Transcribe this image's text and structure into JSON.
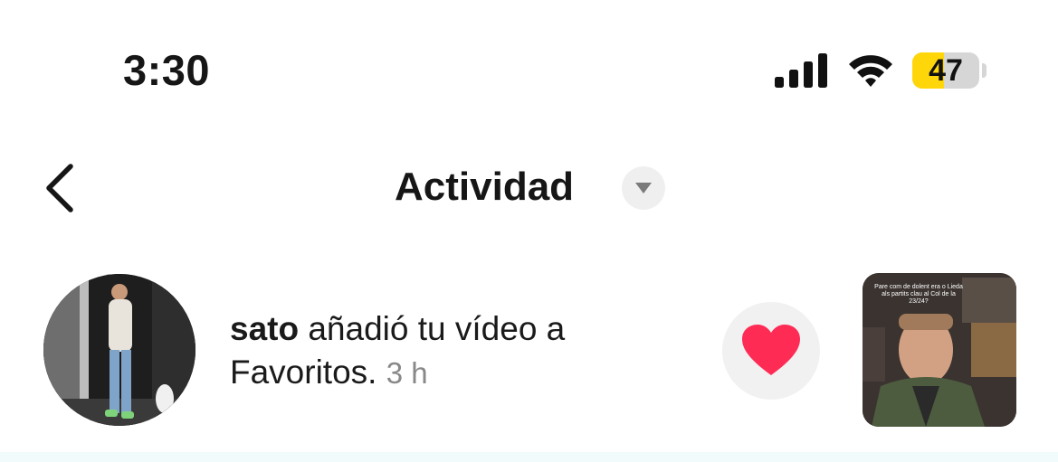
{
  "status_bar": {
    "time": "3:30",
    "battery_level": "47",
    "battery_fraction": 0.47,
    "signal_icon": "cellular-signal-icon",
    "wifi_icon": "wifi-icon"
  },
  "header": {
    "title": "Actividad",
    "back_icon": "chevron-left-icon",
    "dropdown_icon": "caret-down-icon"
  },
  "activity": {
    "username": "sato",
    "action": " añadió tu vídeo a Favoritos.",
    "time_ago": "3 h",
    "reaction_icon": "heart-icon",
    "thumbnail_caption": "Pare com de dolent era o\nLieda als partits clau al\nCol de la 23/24?"
  },
  "colors": {
    "heart": "#fe2c55",
    "battery_fill": "#ffd60a",
    "muted_text": "#888888"
  }
}
